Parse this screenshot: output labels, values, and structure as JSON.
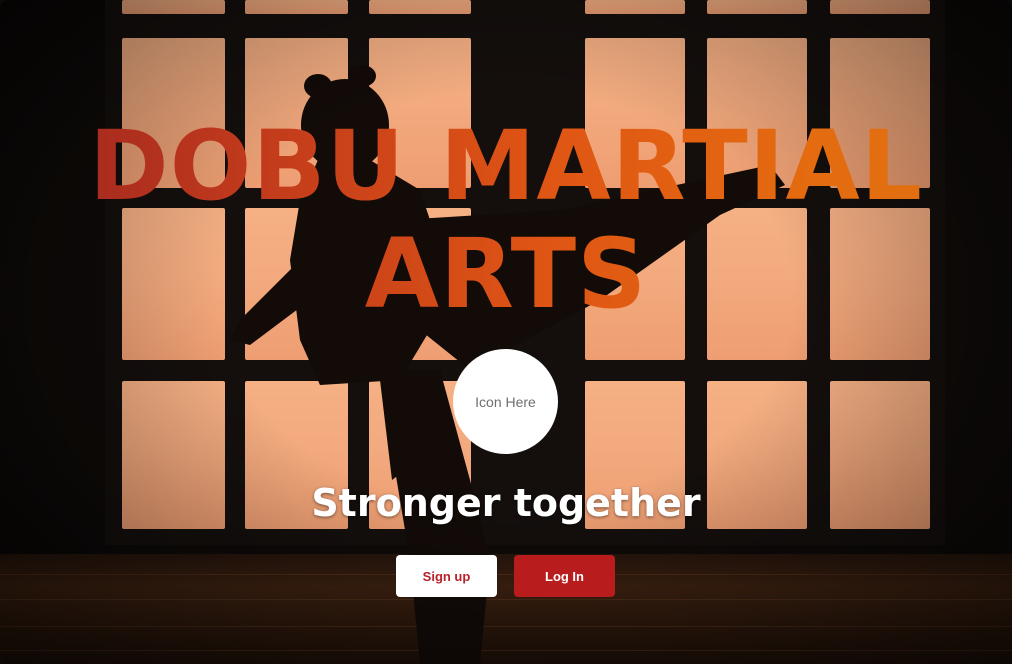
{
  "hero": {
    "title": "DOBU MARTIAL ARTS",
    "icon_placeholder": "Icon Here",
    "tagline": "Stronger together",
    "signup_label": "Sign up",
    "login_label": "Log In"
  },
  "colors": {
    "title_gradient_start": "#9c2420",
    "title_gradient_end": "#e0730e",
    "login_button": "#b91c1c",
    "signup_text": "#b8222c"
  },
  "background": {
    "image": "silhouette of martial artist kicking in front of backlit window grid"
  }
}
